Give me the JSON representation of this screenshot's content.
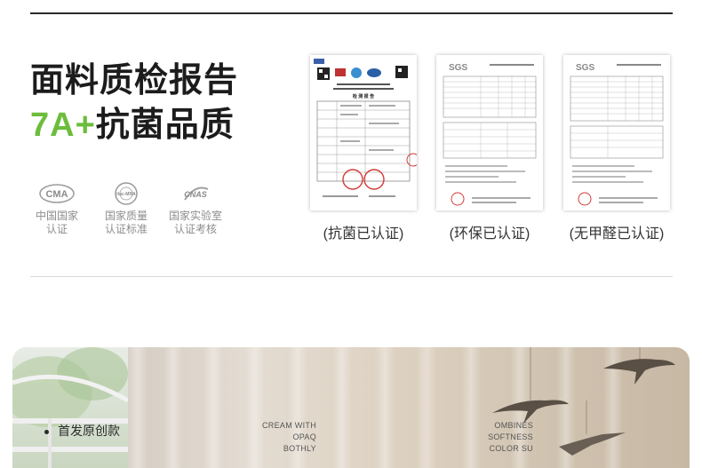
{
  "header": {
    "title_line1": "面料质检报告",
    "title_line2_accent": "7A+",
    "title_line2_rest": "抗菌品质"
  },
  "badges": [
    {
      "logo": "CMA",
      "label_line1": "中国国家",
      "label_line2": "认证",
      "icon": "cma-logo-icon"
    },
    {
      "logo": "ilac-MRA",
      "label_line1": "国家质量",
      "label_line2": "认证标准",
      "icon": "ilac-mra-logo-icon"
    },
    {
      "logo": "CNAS",
      "label_line1": "国家实验室",
      "label_line2": "认证考核",
      "icon": "cnas-logo-icon"
    }
  ],
  "certificates": [
    {
      "caption": "(抗菌已认证)",
      "brand": "",
      "doc_title": "检 测 报 告"
    },
    {
      "caption": "(环保已认证)",
      "brand": "SGS",
      "doc_title": ""
    },
    {
      "caption": "(无甲醛已认证)",
      "brand": "SGS",
      "doc_title": ""
    }
  ],
  "banner": {
    "tag": "首发原创款",
    "text_left_line1": "CREAM WITH OPAQ",
    "text_left_line2": "BOTHLY",
    "text_right_line1": "OMBINES SOFTNESS",
    "text_right_line2": "COLOR SU"
  },
  "colors": {
    "accent": "#6cbd3b",
    "stamp": "#d23b36",
    "text": "#1c1c1c",
    "muted": "#8d8d8d"
  }
}
